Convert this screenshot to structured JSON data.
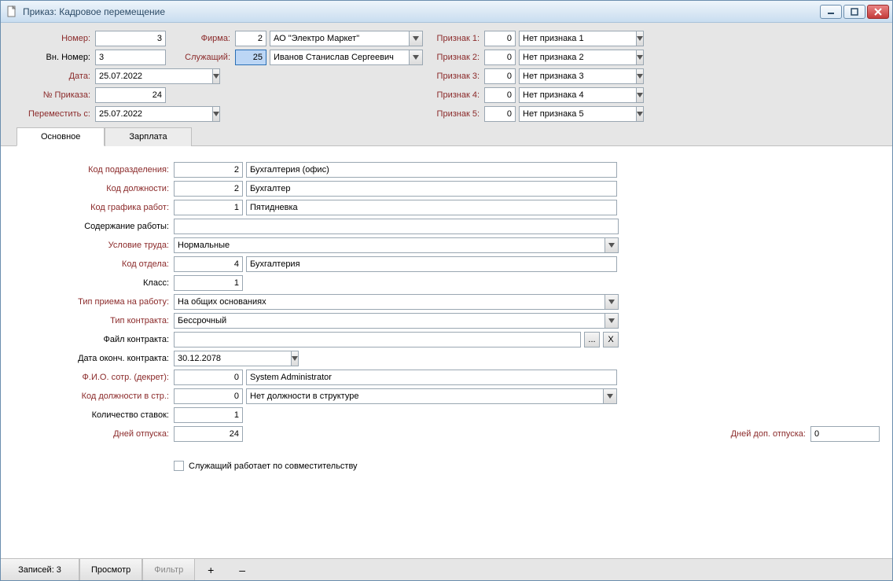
{
  "window": {
    "title": "Приказ: Кадровое перемещение"
  },
  "header": {
    "nomer_label": "Номер:",
    "nomer": "3",
    "vn_nomer_label": "Вн. Номер:",
    "vn_nomer": "3",
    "data_label": "Дата:",
    "data": "25.07.2022",
    "nprikaza_label": "№ Приказа:",
    "nprikaza": "24",
    "peremestit_label": "Переместить с:",
    "peremestit": "25.07.2022",
    "firma_label": "Фирма:",
    "firma_code": "2",
    "firma_name": "АО \"Электро Маркет\"",
    "sluzh_label": "Служащий:",
    "sluzh_code": "25",
    "sluzh_name": "Иванов Станислав Сергеевич",
    "p1_label": "Признак 1:",
    "p1_code": "0",
    "p1_name": "Нет признака 1",
    "p2_label": "Признак 2:",
    "p2_code": "0",
    "p2_name": "Нет признака 2",
    "p3_label": "Признак 3:",
    "p3_code": "0",
    "p3_name": "Нет признака 3",
    "p4_label": "Признак 4:",
    "p4_code": "0",
    "p4_name": "Нет признака 4",
    "p5_label": "Признак 5:",
    "p5_code": "0",
    "p5_name": "Нет признака 5"
  },
  "tabs": {
    "main": "Основное",
    "salary": "Зарплата"
  },
  "main": {
    "kod_podr_label": "Код подразделения:",
    "kod_podr": "2",
    "kod_podr_name": "Бухгалтерия (офис)",
    "kod_dolzh_label": "Код должности:",
    "kod_dolzh": "2",
    "kod_dolzh_name": "Бухгалтер",
    "kod_graf_label": "Код графика работ:",
    "kod_graf": "1",
    "kod_graf_name": "Пятидневка",
    "soderzh_label": "Содержание работы:",
    "soderzh": "",
    "uslovie_label": "Условие труда:",
    "uslovie": "Нормальные",
    "kod_otd_label": "Код отдела:",
    "kod_otd": "4",
    "kod_otd_name": "Бухгалтерия",
    "klass_label": "Класс:",
    "klass": "1",
    "tip_priema_label": "Тип приема на работу:",
    "tip_priema": "На общих основаниях",
    "tip_kontr_label": "Тип контракта:",
    "tip_kontr": "Бессрочный",
    "file_kontr_label": "Файл контракта:",
    "file_kontr": "",
    "data_okonch_label": "Дата оконч. контракта:",
    "data_okonch": "30.12.2078",
    "fio_dekret_label": "Ф.И.О. сотр. (декрет):",
    "fio_dekret_code": "0",
    "fio_dekret_name": "System Administrator",
    "kod_dolzh_str_label": "Код должности в стр.:",
    "kod_dolzh_str": "0",
    "kod_dolzh_str_name": "Нет должности в структуре",
    "kol_stavok_label": "Количество ставок:",
    "kol_stavok": "1",
    "dnei_otp_label": "Дней отпуска:",
    "dnei_otp": "24",
    "dnei_dop_label": "Дней доп. отпуска:",
    "dnei_dop": "0",
    "sovmest_label": "Служащий работает по совместительству",
    "browse_btn": "...",
    "clear_btn": "X"
  },
  "status": {
    "records": "Записей: 3",
    "view": "Просмотр",
    "filter": "Фильтр",
    "plus": "+",
    "minus": "–"
  }
}
